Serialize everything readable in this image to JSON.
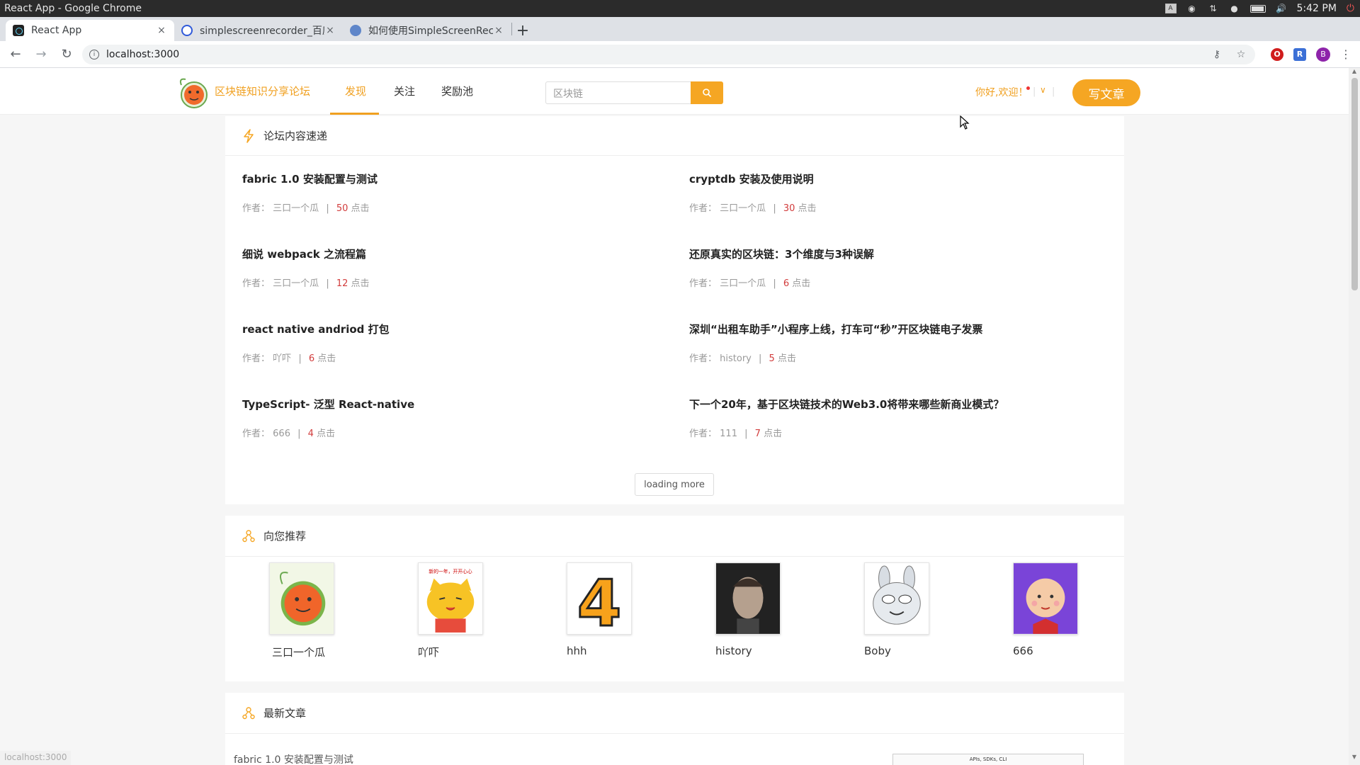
{
  "os": {
    "window_title": "React App - Google Chrome",
    "time": "5:42 PM"
  },
  "tabs": [
    {
      "label": "React App",
      "close": "×"
    },
    {
      "label": "simplescreenrecorder_百度",
      "close": "×"
    },
    {
      "label": "如何使用SimpleScreenRec",
      "close": "×"
    }
  ],
  "newtab": "+",
  "address": {
    "url": "localhost:3000",
    "info": "i",
    "profile": "B",
    "ext_r": "R"
  },
  "header": {
    "brand": "区块链知识分享论坛",
    "nav": [
      "发现",
      "关注",
      "奖励池"
    ],
    "search_placeholder": "区块链",
    "greeting": "你好,欢迎！",
    "write_label": "写文章"
  },
  "panel_feed": {
    "title": "论坛内容速递",
    "author_prefix": "作者：",
    "clicks_suffix": "点击",
    "articles": [
      {
        "title": "fabric 1.0 安装配置与测试",
        "author": "三口一个瓜",
        "clicks": "50"
      },
      {
        "title": "cryptdb 安装及使用说明",
        "author": "三口一个瓜",
        "clicks": "30"
      },
      {
        "title": "细说 webpack 之流程篇",
        "author": "三口一个瓜",
        "clicks": "12"
      },
      {
        "title": "还原真实的区块链：3个维度与3种误解",
        "author": "三口一个瓜",
        "clicks": "6"
      },
      {
        "title": "react native andriod 打包",
        "author": "吖吓",
        "clicks": "6"
      },
      {
        "title": "深圳“出租车助手”小程序上线，打车可“秒”开区块链电子发票",
        "author": "history",
        "clicks": "5"
      },
      {
        "title": "TypeScript- 泛型 React-native",
        "author": "666",
        "clicks": "4"
      },
      {
        "title": "下一个20年，基于区块链技术的Web3.0将带来哪些新商业模式？",
        "author": "111",
        "clicks": "7"
      }
    ],
    "load_more": "loading more"
  },
  "panel_recommend": {
    "title": "向您推荐",
    "users": [
      {
        "name": "三口一个瓜"
      },
      {
        "name": "吖吓"
      },
      {
        "name": "hhh"
      },
      {
        "name": "history"
      },
      {
        "name": "Boby"
      },
      {
        "name": "666"
      }
    ],
    "avatar_texts": {
      "four": "4",
      "cat_banner": "新的一年，开开心心"
    }
  },
  "panel_latest": {
    "title": "最新文章",
    "first_article": "fabric 1.0 安装配置与测试",
    "image_caption": "APIs, SDKs, CLI"
  },
  "status_bar_url": "localhost:3000",
  "colors": {
    "accent": "#f5a623",
    "click_count": "#d23c3c"
  }
}
